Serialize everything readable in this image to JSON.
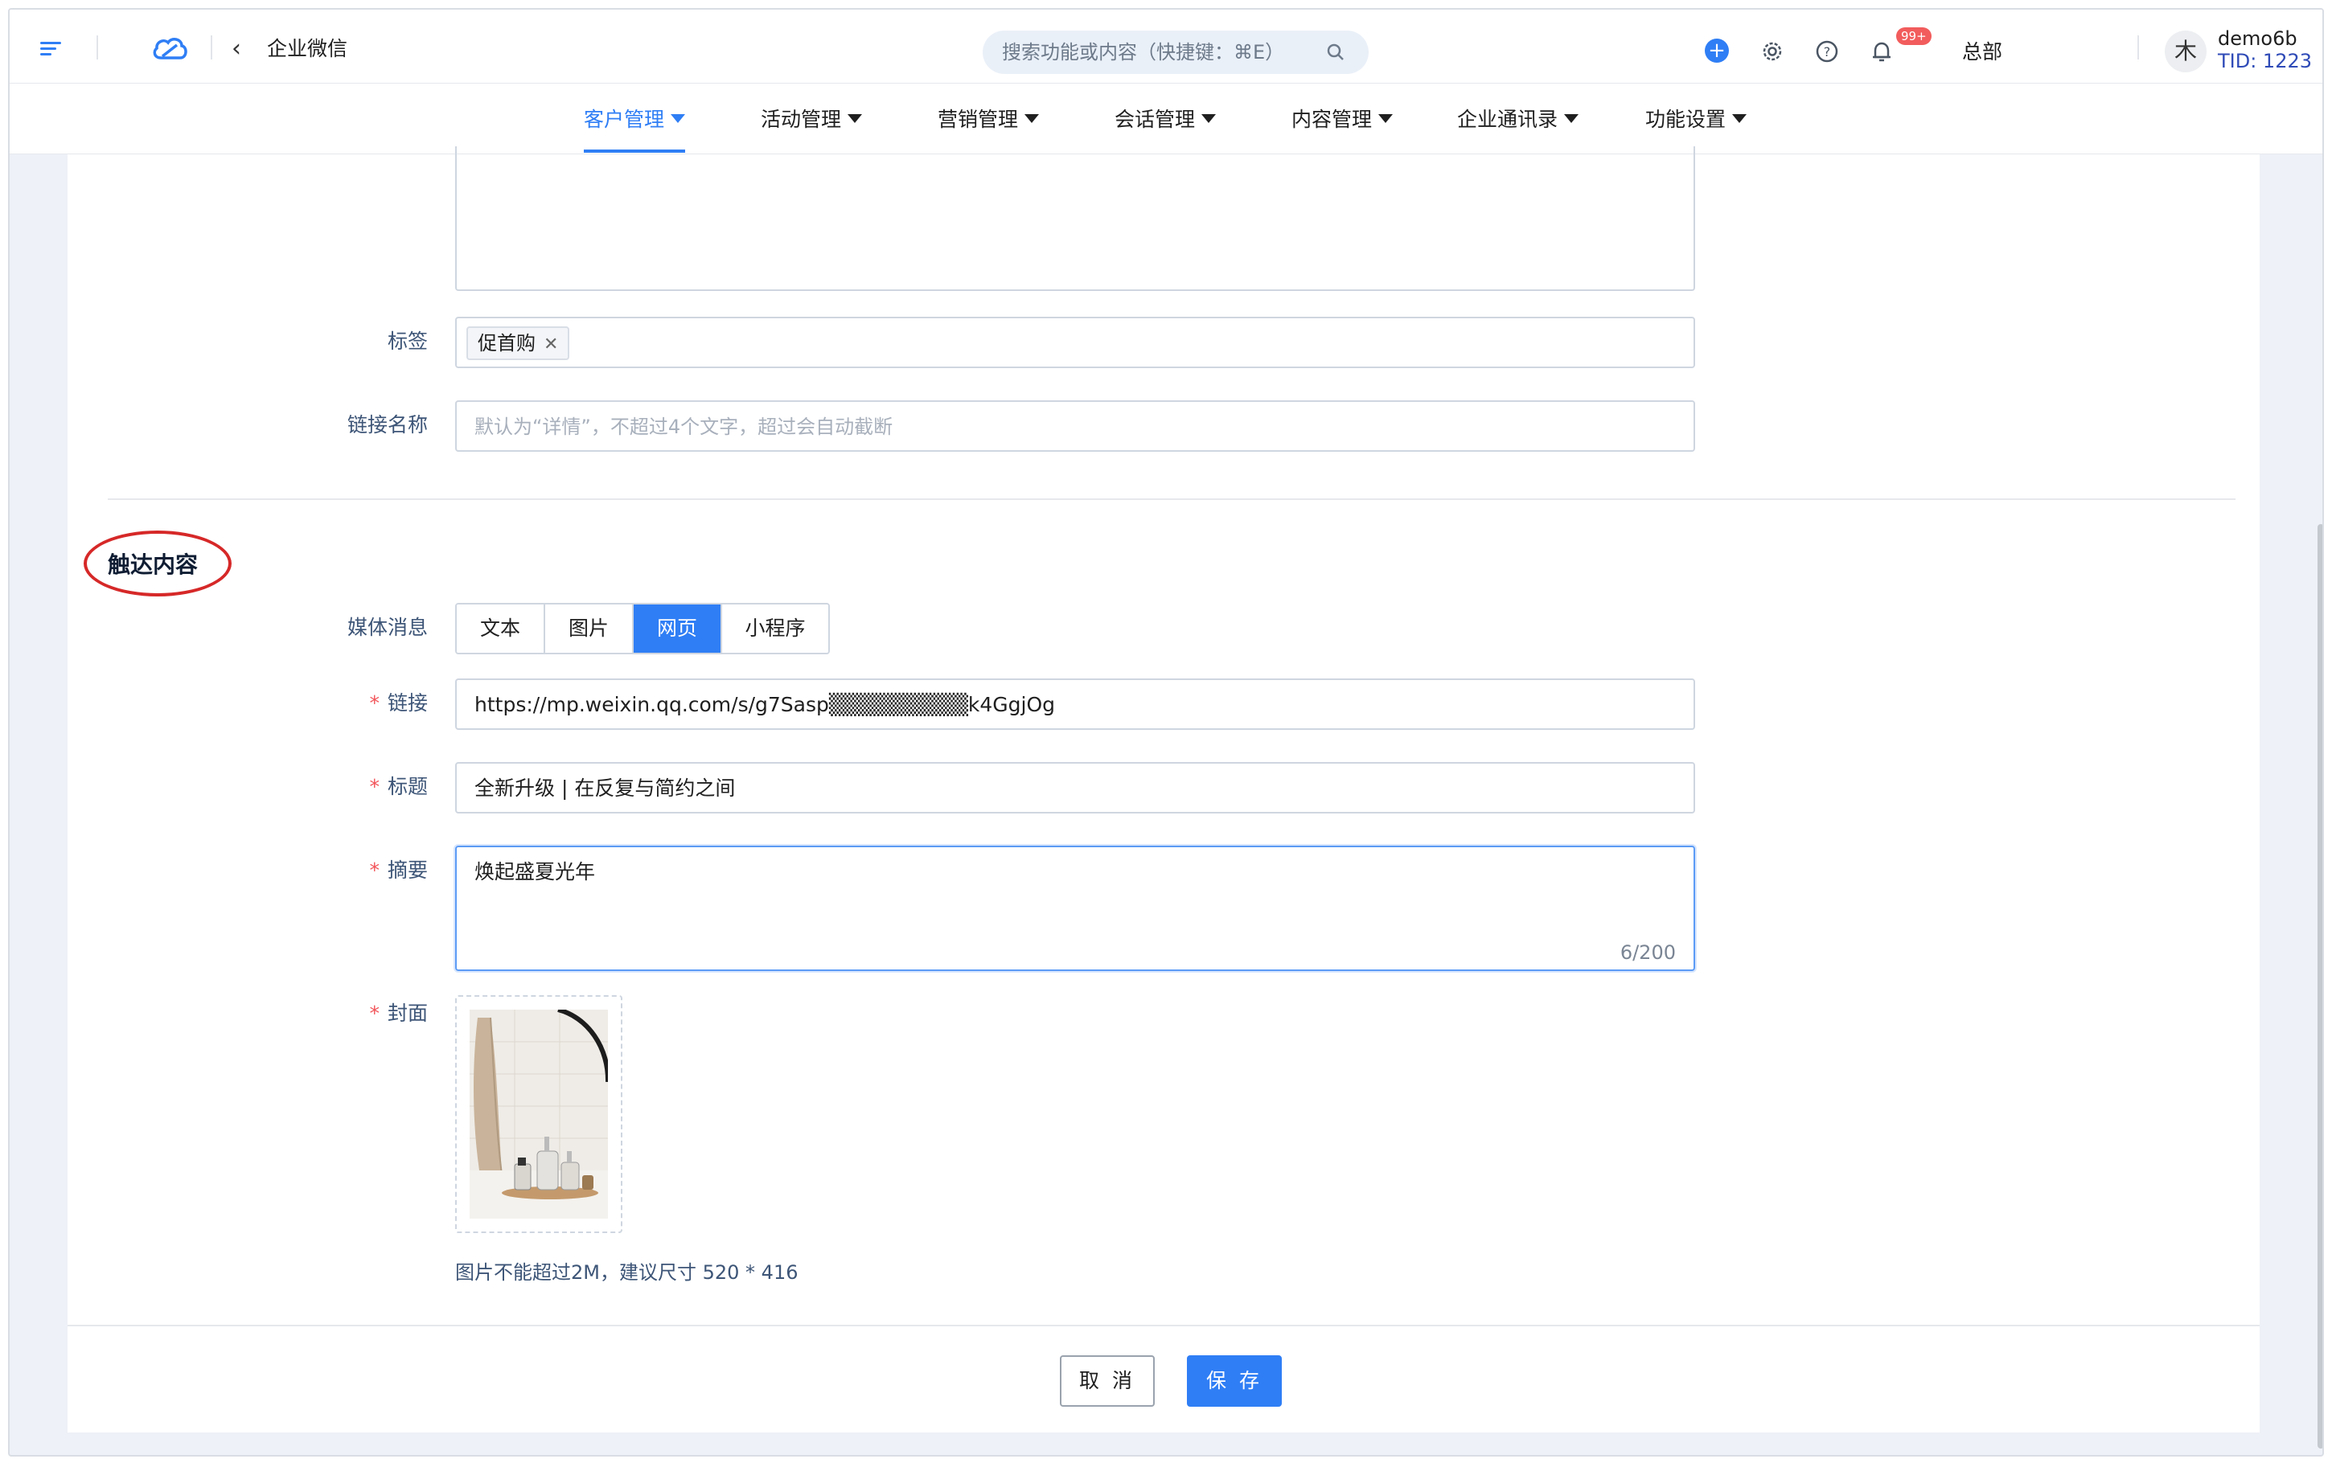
{
  "header": {
    "app_title": "企业微信",
    "search_placeholder": "搜索功能或内容（快捷键：⌘E）",
    "notification_badge": "99+",
    "org_name": "总部",
    "avatar_text": "木",
    "user_name": "demo6b",
    "user_tid": "TID: 1223"
  },
  "nav": {
    "items": [
      {
        "label": "客户管理",
        "active": true
      },
      {
        "label": "活动管理"
      },
      {
        "label": "营销管理"
      },
      {
        "label": "会话管理"
      },
      {
        "label": "内容管理"
      },
      {
        "label": "企业通讯录"
      },
      {
        "label": "功能设置"
      }
    ]
  },
  "form": {
    "tags_label": "标签",
    "tags": [
      "促首购"
    ],
    "link_name_label": "链接名称",
    "link_name_placeholder": "默认为“详情”，不超过4个文字，超过会自动截断",
    "section_title": "触达内容",
    "media_label": "媒体消息",
    "media_options": [
      "文本",
      "图片",
      "网页",
      "小程序"
    ],
    "media_selected": "网页",
    "link_label": "链接",
    "link_value": "https://mp.weixin.qq.com/s/g7Sasp▒▒▒▒▒▒▒▒▒k4GgjOg",
    "title_label": "标题",
    "title_value": "全新升级 | 在反复与简约之间",
    "summary_label": "摘要",
    "summary_value": "焕起盛夏光年",
    "summary_count": "6/200",
    "cover_label": "封面",
    "cover_hint": "图片不能超过2M，建议尺寸 520 * 416"
  },
  "footer": {
    "cancel_label": "取 消",
    "save_label": "保 存"
  },
  "colors": {
    "accent": "#2f7ef5",
    "required": "#f2555a",
    "annotation": "#d62828"
  }
}
